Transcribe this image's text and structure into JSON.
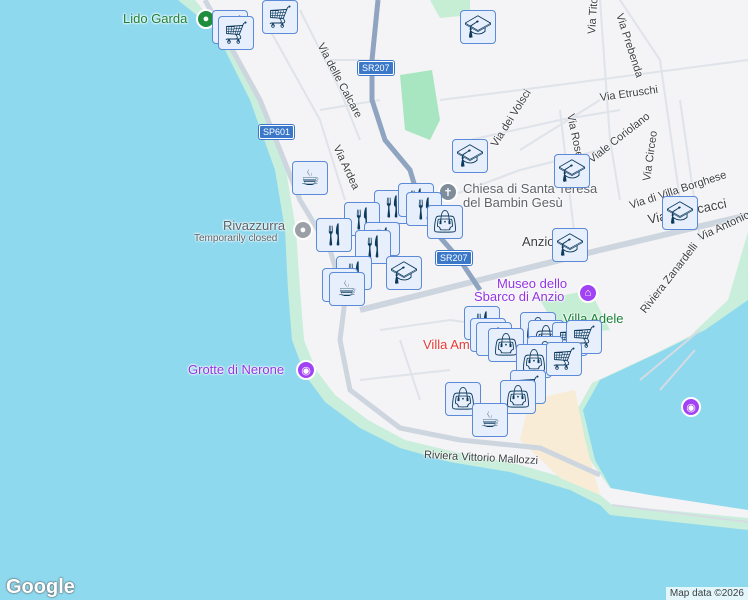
{
  "colors": {
    "sea": "#8fd9ee",
    "land": "#f4f3f5",
    "park": "#a8e6c1",
    "marker_fill": "#e7eefc",
    "marker_border": "#5b8ad8",
    "icon": "#0b3a5c"
  },
  "places": {
    "lido_garda": "Lido Garda",
    "rivazzurra": "Rivazzurra",
    "rivazzurra_status": "Temporarily closed",
    "chiesa_line1": "Chiesa di Santa Teresa",
    "chiesa_line2": "del Bambin Gesù",
    "museo_line1": "Museo dello",
    "museo_line2": "Sbarco di Anzio",
    "villa_adele": "Villa Adele",
    "villa_am": "Villa Am",
    "grotte": "Grotte di Nerone",
    "anzio": "Anzio"
  },
  "streets": {
    "calcare": "Via delle Calcare",
    "ardea": "Via Ardea",
    "volsci": "Via dei Volsci",
    "roselli": "Via Roselli",
    "coriolano": "Viale Coriolano",
    "etruschi": "Via Etruschi",
    "prebenda": "Via Prebenda",
    "livio": "Via Tito Livio",
    "circeo": "Via Circeo",
    "borghese": "Via di Villa Borghese",
    "menicacci": "Via Menicacci",
    "antonio": "Via Antonio",
    "zanardelli": "Riviera Zanardelli",
    "mallozzi": "Riviera Vittorio Mallozzi"
  },
  "shields": {
    "sr207_a": "SR207",
    "sr207_b": "SR207",
    "sp601": "SP601"
  },
  "marker_icons": {
    "cart": "shopping-cart-icon",
    "food": "restaurant-icon",
    "cafe": "coffee-cup-icon",
    "school": "graduation-cap-icon",
    "bag": "shopping-bag-icon"
  },
  "branding": {
    "logo": "Google",
    "attribution": "Map data ©2026"
  }
}
